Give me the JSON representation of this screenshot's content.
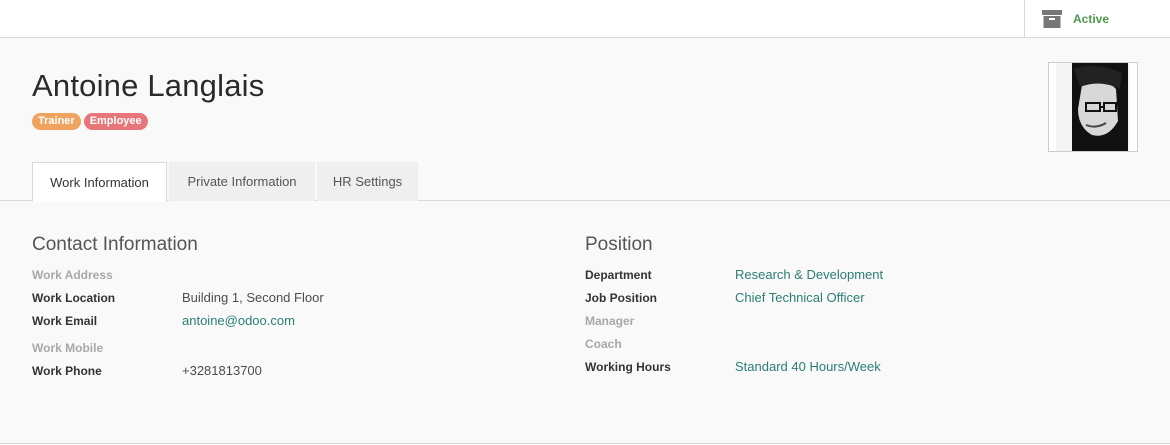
{
  "status_button": {
    "label": "Active",
    "icon": "archive-icon",
    "color": "#4c9a4c"
  },
  "employee": {
    "name": "Antoine Langlais",
    "tags": [
      {
        "label": "Trainer",
        "color": "#f0a35e"
      },
      {
        "label": "Employee",
        "color": "#e6767a"
      }
    ],
    "photo": "avatar-photo"
  },
  "tabs": [
    {
      "label": "Work Information",
      "active": true
    },
    {
      "label": "Private Information",
      "active": false
    },
    {
      "label": "HR Settings",
      "active": false
    }
  ],
  "contact": {
    "title": "Contact Information",
    "fields": [
      {
        "label": "Work Address",
        "value": ""
      },
      {
        "label": "Work Location",
        "value": "Building 1, Second Floor"
      },
      {
        "label": "Work Email",
        "value": "antoine@odoo.com"
      },
      {
        "label": "Work Mobile",
        "value": ""
      },
      {
        "label": "Work Phone",
        "value": "+3281813700"
      }
    ]
  },
  "position": {
    "title": "Position",
    "fields": [
      {
        "label": "Department",
        "value": "Research & Development"
      },
      {
        "label": "Job Position",
        "value": "Chief Technical Officer"
      },
      {
        "label": "Manager",
        "value": ""
      },
      {
        "label": "Coach",
        "value": ""
      },
      {
        "label": "Working Hours",
        "value": "Standard 40 Hours/Week"
      }
    ]
  },
  "colors": {
    "link": "#2c7e75",
    "muted_label": "#a8a8a8"
  }
}
